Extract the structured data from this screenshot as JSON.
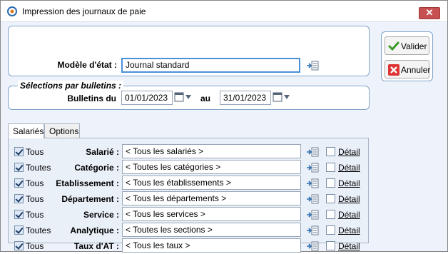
{
  "window": {
    "title": "Impression des journaux de paie",
    "close_glyph": "✕"
  },
  "model": {
    "label": "Modèle d'état :",
    "value": "Journal standard"
  },
  "selections": {
    "legend": "Sélections par bulletins :",
    "bulletins_label": "Bulletins du",
    "from_date": "01/01/2023",
    "to_label": "au",
    "to_date": "31/01/2023"
  },
  "tabs": [
    {
      "label": "Salariés"
    },
    {
      "label": "Options"
    }
  ],
  "rows": [
    {
      "check_label": "Tous",
      "label": "Salarié :",
      "value": "< Tous les salariés >",
      "detail": "Détail"
    },
    {
      "check_label": "Toutes",
      "label": "Catégorie :",
      "value": "< Toutes les catégories >",
      "detail": "Détail"
    },
    {
      "check_label": "Tous",
      "label": "Etablissement :",
      "value": "< Tous les établissements >",
      "detail": "Détail"
    },
    {
      "check_label": "Tous",
      "label": "Département :",
      "value": "< Tous les départements >",
      "detail": "Détail"
    },
    {
      "check_label": "Tous",
      "label": "Service :",
      "value": "< Tous les services >",
      "detail": "Détail"
    },
    {
      "check_label": "Toutes",
      "label": "Analytique :",
      "value": "< Toutes les sections >",
      "detail": "Détail"
    },
    {
      "check_label": "Tous",
      "label": "Taux d'AT :",
      "value": "< Tous les taux >",
      "detail": "Détail"
    }
  ],
  "buttons": {
    "validate": "Valider",
    "cancel": "Annuler"
  },
  "colors": {
    "accent": "#7fa3c8",
    "focus": "#4a90d9",
    "close": "#c75050"
  },
  "icons": [
    "app-icon",
    "list-selector-icon",
    "calendar-icon",
    "dropdown-arrow-icon",
    "check-icon",
    "cancel-x-icon"
  ]
}
